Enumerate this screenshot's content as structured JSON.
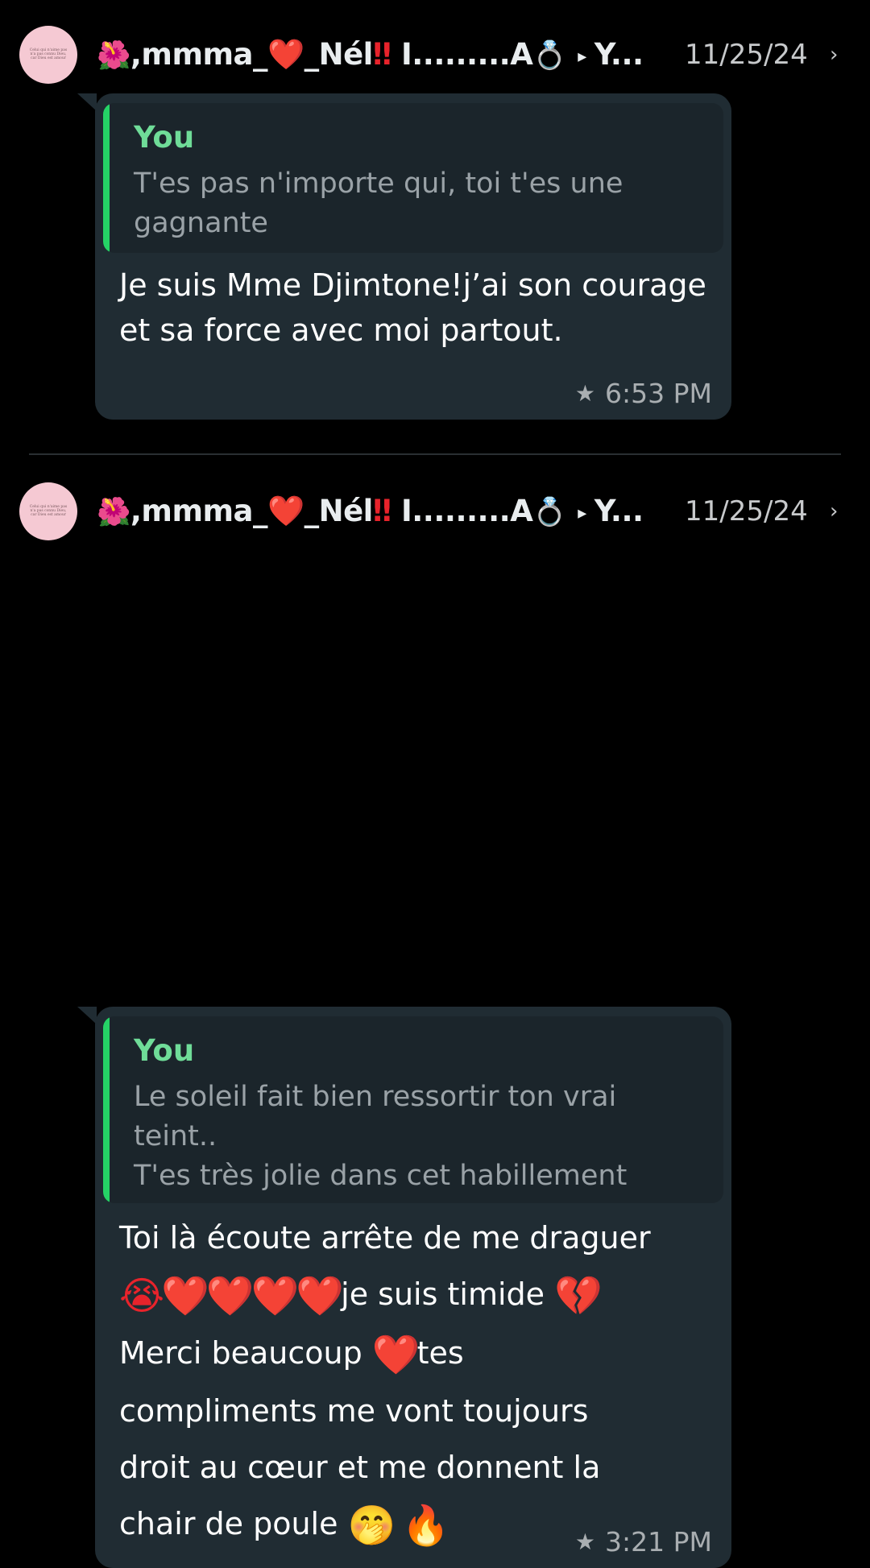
{
  "entries": [
    {
      "sender": {
        "flower_emoji": "🌺",
        "name_part1": ",mmma_",
        "heart": "❤️",
        "name_part2": "_Nél",
        "exclaim": "‼",
        "name_part3": "I.........A",
        "ring_emoji": "💍",
        "arrow": "▸",
        "recipient": "Y..."
      },
      "avatar_caption": "Celui qui n'aime pas n'a pas connu Dieu, car Dieu est amour",
      "date": "11/25/24",
      "chevron": "›",
      "quote": {
        "author": "You",
        "text": "T'es pas n'importe qui, toi t'es une gagnante"
      },
      "message": "Je suis Mme Djimtone!j’ai son courage et sa force avec moi partout.",
      "star_icon": "★",
      "time": "6:53 PM"
    },
    {
      "sender": {
        "flower_emoji": "🌺",
        "name_part1": ",mmma_",
        "heart": "❤️",
        "name_part2": "_Nél",
        "exclaim": "‼",
        "name_part3": "I.........A",
        "ring_emoji": "💍",
        "arrow": "▸",
        "recipient": "Y..."
      },
      "avatar_caption": "Celui qui n'aime pas n'a pas connu Dieu, car Dieu est amour",
      "date": "11/25/24",
      "chevron": "›",
      "quote": {
        "author": "You",
        "line1": "Le soleil fait bien ressortir ton vrai",
        "line2": "teint..",
        "line3": "T'es très jolie dans cet habillement"
      },
      "message": {
        "line1": "Toi là écoute arrête de me draguer",
        "emojis": "😭❤️❤️❤️❤️",
        "line2_text": "je suis timide",
        "broken_heart": "💔",
        "line3_text": "Merci beaucoup",
        "heart": "❤️",
        "line3_tail": "tes",
        "line4": "compliments me vont toujours",
        "line5": "droit au cœur et me donnent la",
        "line6_text": "chair de poule",
        "end_emojis": "🤭 🔥"
      },
      "star_icon": "★",
      "time": "3:21 PM"
    }
  ],
  "colors": {
    "background": "#000000",
    "bubble": "#202c33",
    "quote_background": "#1b252b",
    "quote_bar": "#25d366",
    "quote_author": "#6fdc98"
  }
}
